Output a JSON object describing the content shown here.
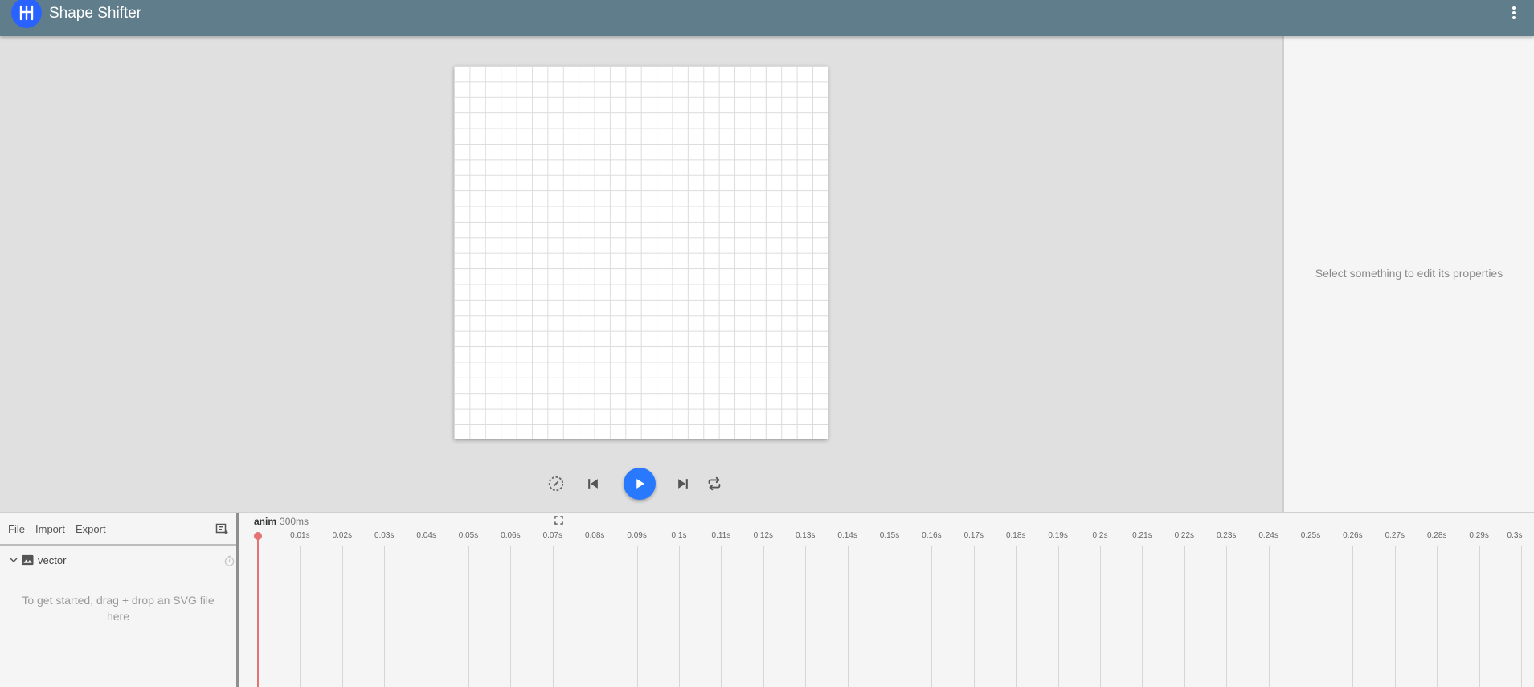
{
  "app": {
    "title": "Shape Shifter",
    "brand_color": "#607d8b",
    "logo_color": "#2962ff"
  },
  "playback": {
    "accent_color": "#2979ff",
    "buttons": [
      "speed-icon",
      "skip-previous-icon",
      "play-icon",
      "skip-next-icon",
      "repeat-icon"
    ]
  },
  "properties": {
    "empty_message": "Select something to edit its properties"
  },
  "layers_panel": {
    "menu": {
      "file": "File",
      "import": "Import",
      "export": "Export"
    },
    "layer_name": "vector",
    "empty_message": "To get started, drag + drop an SVG file here"
  },
  "timeline": {
    "animation_name": "anim",
    "duration": "300ms",
    "ticks": [
      "0.01s",
      "0.02s",
      "0.03s",
      "0.04s",
      "0.05s",
      "0.06s",
      "0.07s",
      "0.08s",
      "0.09s",
      "0.1s",
      "0.11s",
      "0.12s",
      "0.13s",
      "0.14s",
      "0.15s",
      "0.16s",
      "0.17s",
      "0.18s",
      "0.19s",
      "0.2s",
      "0.21s",
      "0.22s",
      "0.23s",
      "0.24s",
      "0.25s",
      "0.26s",
      "0.27s",
      "0.28s",
      "0.29s",
      "0.3s"
    ],
    "playhead_color": "#e57373"
  }
}
